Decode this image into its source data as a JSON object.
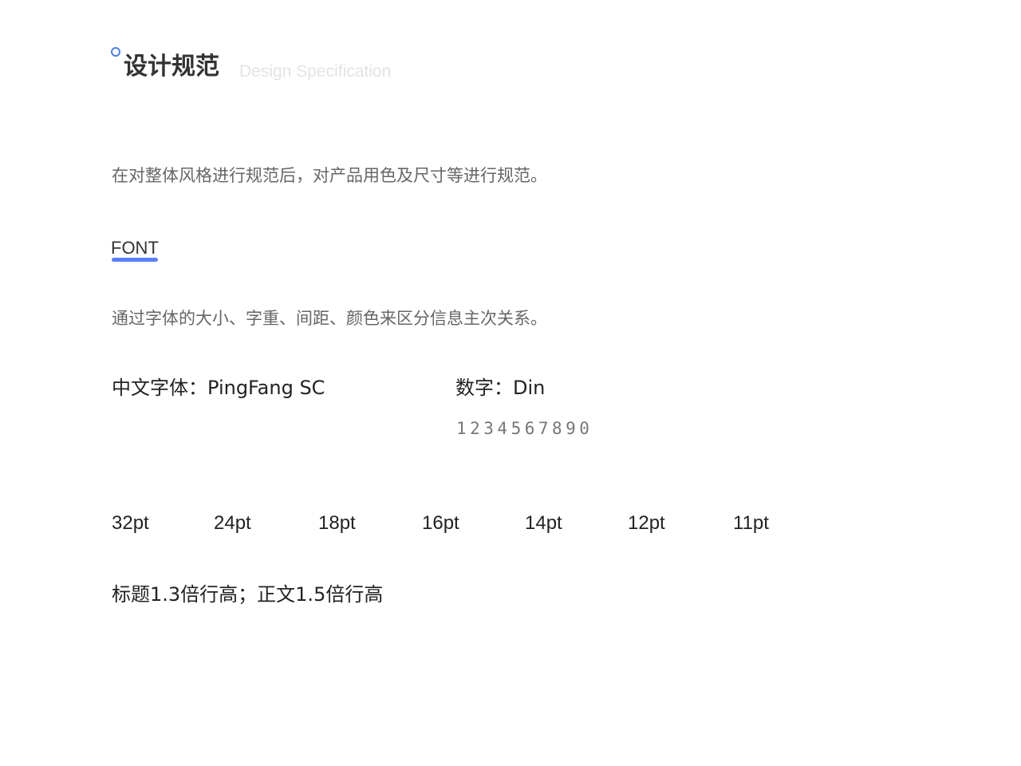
{
  "header": {
    "title_zh": "设计规范",
    "title_en": "Design Specification"
  },
  "intro": "在对整体风格进行规范后，对产品用色及尺寸等进行规范。",
  "font_section": {
    "title": "FONT",
    "description": "通过字体的大小、字重、间距、颜色来区分信息主次关系。",
    "chinese_font": "中文字体：PingFang SC",
    "number_font": "数字：Din",
    "digits_sample": "1234567890",
    "sizes": [
      "32pt",
      "24pt",
      "18pt",
      "16pt",
      "14pt",
      "12pt",
      "11pt"
    ],
    "line_height_note": "标题1.3倍行高；正文1.5倍行高"
  },
  "colors": {
    "accent": "#5b7ff5",
    "dot": "#4a7fe0",
    "title": "#333333",
    "subtitle": "#e3e3e3",
    "body_text": "#666666"
  }
}
